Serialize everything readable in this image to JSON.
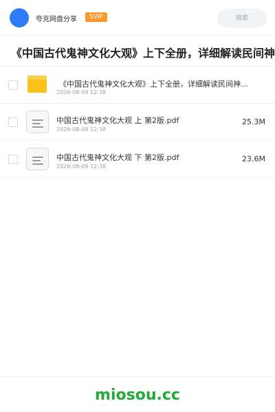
{
  "header": {
    "app_name": "夸克网盘分享",
    "badge": "SVIP",
    "search_placeholder": "搜索"
  },
  "page_title": "《中国古代鬼神文化大观》上下全册，详细解读民间神鬼世界",
  "files": [
    {
      "type": "folder",
      "name": "《中国古代鬼神文化大观》上下全册，详细解读民间神鬼世界",
      "date": "2026-08-09 12:38",
      "size": ""
    },
    {
      "type": "file",
      "name": "中国古代鬼神文化大观 上 第2版.pdf",
      "date": "2026-08-09 12:38",
      "size": "25.3M"
    },
    {
      "type": "file",
      "name": "中国古代鬼神文化大观 下 第2版.pdf",
      "date": "2026-08-09 12:38",
      "size": "23.6M"
    }
  ],
  "footer": {
    "watermark": "miosou.cc"
  },
  "colors": {
    "avatar": "#2f7df6",
    "badge": "#f79a2a",
    "folder": "#f8c21a",
    "watermark": "#22a93a"
  },
  "icons": [
    "avatar",
    "folder-icon",
    "file-icon",
    "checkbox"
  ]
}
